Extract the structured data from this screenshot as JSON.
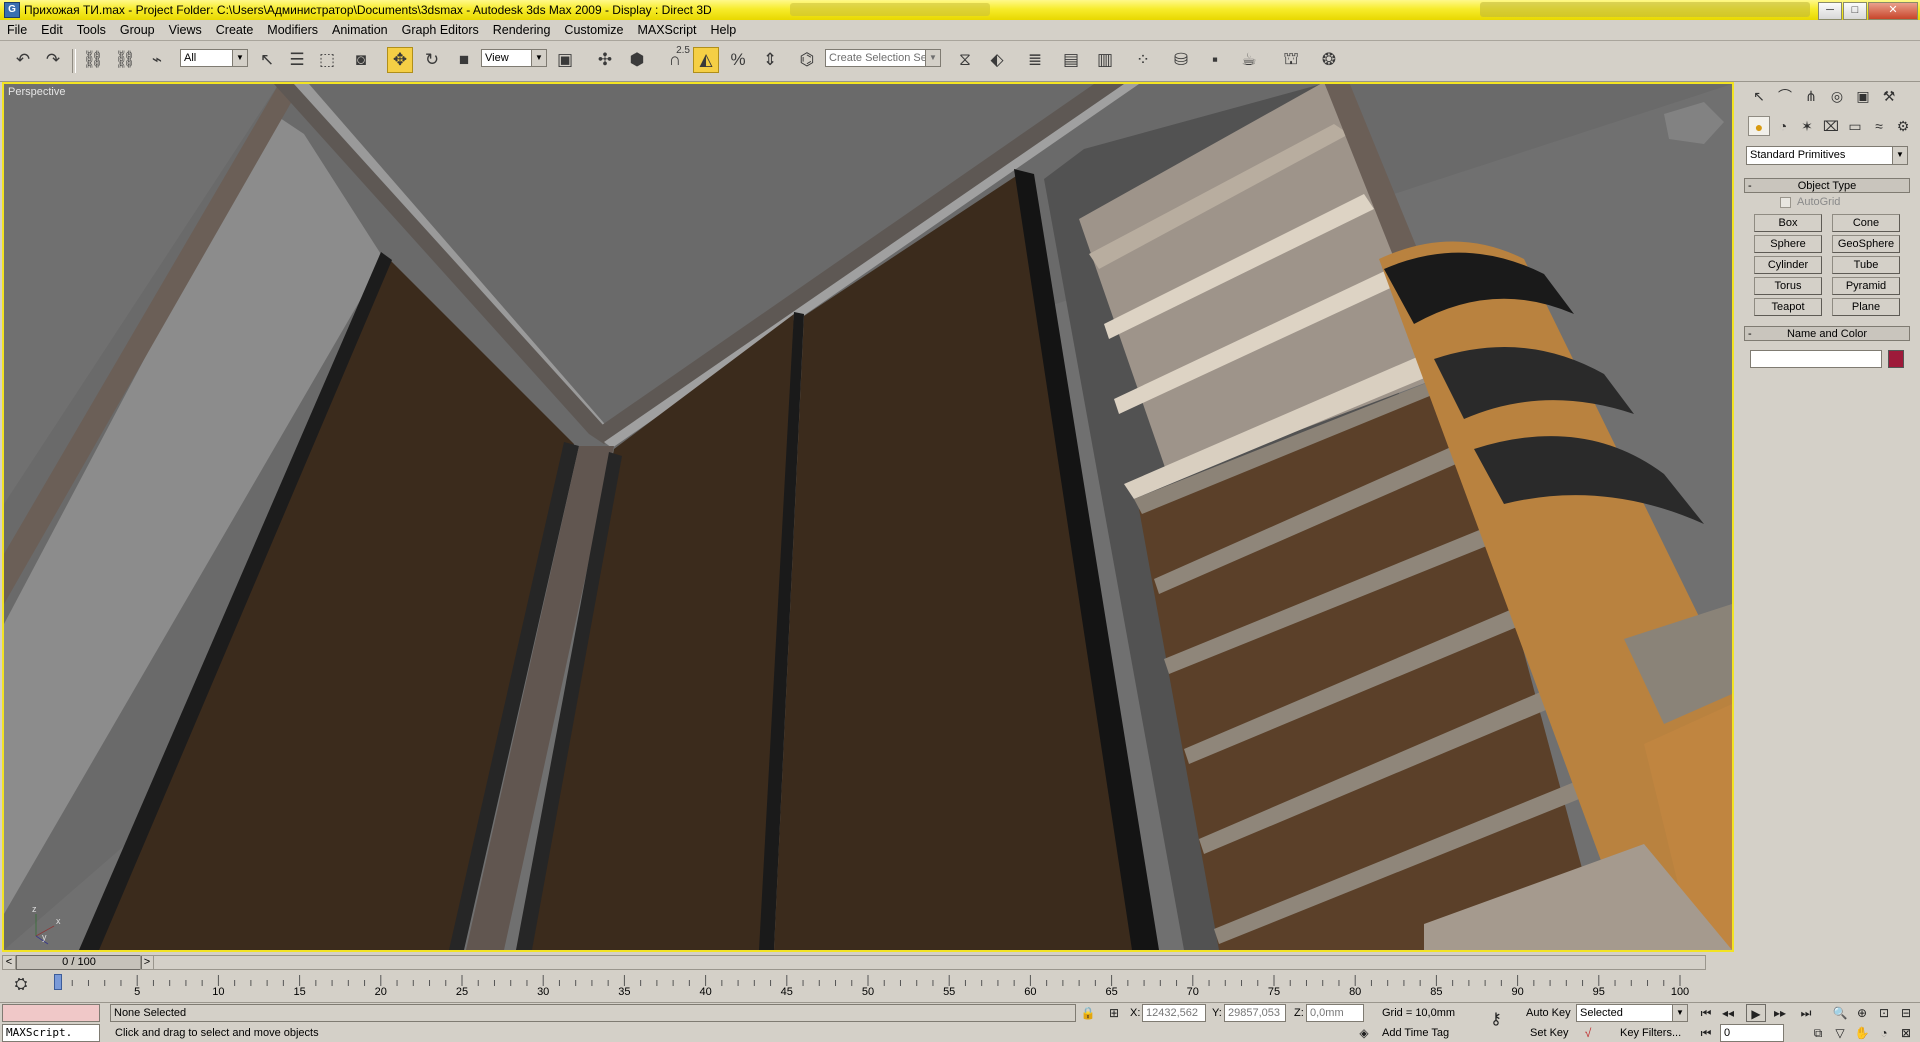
{
  "window": {
    "title": "Прихожая ТИ.max     - Project Folder: C:\\Users\\Администратор\\Documents\\3dsmax      - Autodesk 3ds Max  2009       - Display : Direct 3D",
    "app_icon": "3dsmax-logo-icon",
    "minimize": "─",
    "maximize": "□",
    "close": "✕"
  },
  "menu": [
    "File",
    "Edit",
    "Tools",
    "Group",
    "Views",
    "Create",
    "Modifiers",
    "Animation",
    "Graph Editors",
    "Rendering",
    "Customize",
    "MAXScript",
    "Help"
  ],
  "toolbar": {
    "selection_filter": "All",
    "reference_coord": "View",
    "snap_label": "2.5",
    "named_selection_placeholder": "Create Selection Set"
  },
  "viewport": {
    "label": "Perspective",
    "gizmo_axes": [
      "z",
      "y",
      "x"
    ]
  },
  "command_panel": {
    "dropdown": "Standard Primitives",
    "object_type_header": "Object Type",
    "autogrid": "AutoGrid",
    "primitives": [
      "Box",
      "Cone",
      "Sphere",
      "GeoSphere",
      "Cylinder",
      "Tube",
      "Torus",
      "Pyramid",
      "Teapot",
      "Plane"
    ],
    "name_color_header": "Name and Color",
    "object_color": "#9e1a3a"
  },
  "time_slider": {
    "label": "0 / 100",
    "prev": "<",
    "next": ">"
  },
  "track_bar": {
    "ticks": [
      5,
      10,
      15,
      20,
      25,
      30,
      35,
      40,
      45,
      50,
      55,
      60,
      65,
      70,
      75,
      80,
      85,
      90,
      95,
      100
    ]
  },
  "status": {
    "maxscript": "MAXScript.",
    "selection": "None Selected",
    "prompt": "Click and drag to select and move objects",
    "x_label": "X:",
    "x_value": "12432,562",
    "y_label": "Y:",
    "y_value": "29857,053",
    "z_label": "Z:",
    "z_value": "0,0mm",
    "grid": "Grid = 10,0mm",
    "auto_key": "Auto Key",
    "set_key": "Set Key",
    "key_mode": "Selected",
    "key_filters": "Key Filters...",
    "add_time_tag": "Add Time Tag",
    "frame": "0"
  },
  "colors": {
    "title_bar": "#f7ec2c",
    "viewport_border": "#f2e323",
    "active_tool": "#f5cf45"
  }
}
